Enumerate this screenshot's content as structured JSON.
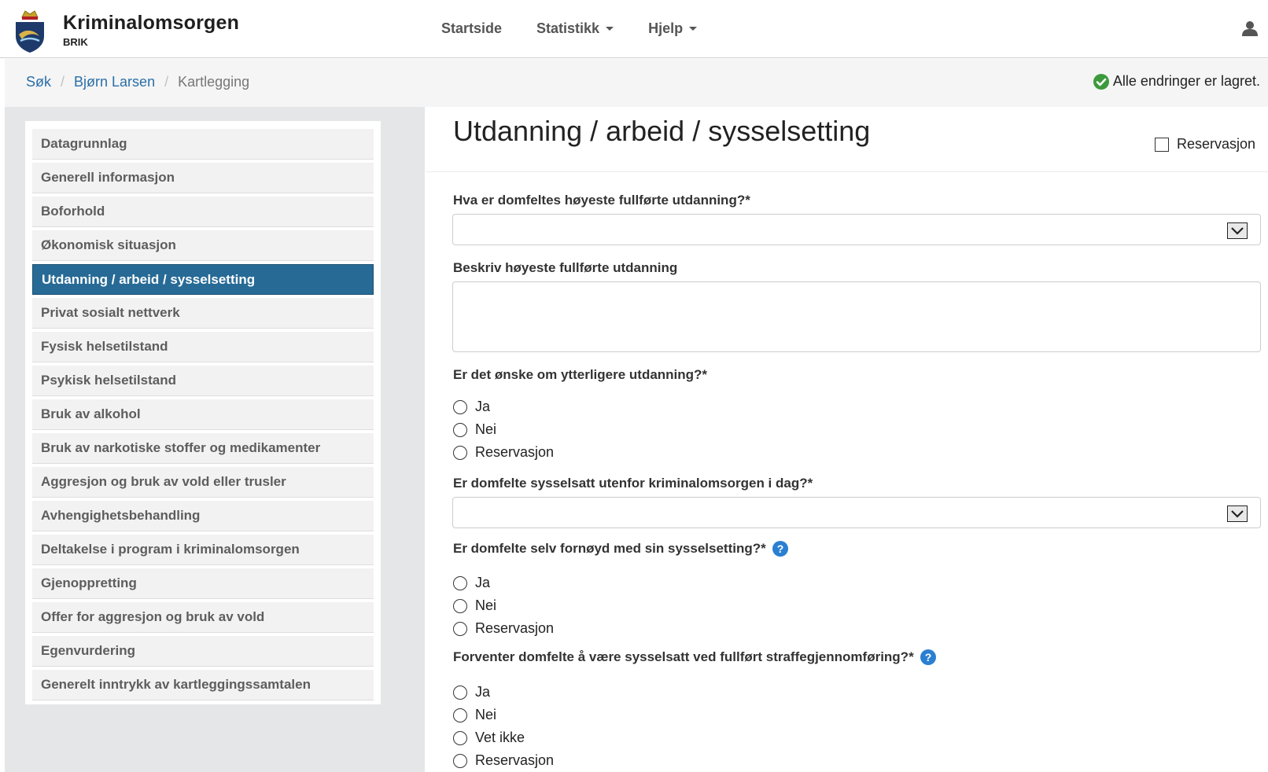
{
  "header": {
    "brand_title": "Kriminalomsorgen",
    "brand_sub": "BRIK",
    "nav": [
      "Startside",
      "Statistikk",
      "Hjelp"
    ]
  },
  "breadcrumb": {
    "items": [
      "Søk",
      "Bjørn Larsen"
    ],
    "current": "Kartlegging"
  },
  "status": {
    "saved_text": "Alle endringer er lagret."
  },
  "sidebar": {
    "items": [
      "Datagrunnlag",
      "Generell informasjon",
      "Boforhold",
      "Økonomisk situasjon",
      "Utdanning / arbeid / sysselsetting",
      "Privat sosialt nettverk",
      "Fysisk helsetilstand",
      "Psykisk helsetilstand",
      "Bruk av alkohol",
      "Bruk av narkotiske stoffer og medikamenter",
      "Aggresjon og bruk av vold eller trusler",
      "Avhengighetsbehandling",
      "Deltakelse i program i kriminalomsorgen",
      "Gjenoppretting",
      "Offer for aggresjon og bruk av vold",
      "Egenvurdering",
      "Generelt inntrykk av kartleggingssamtalen"
    ],
    "active_index": 4
  },
  "main": {
    "title": "Utdanning / arbeid / sysselsetting",
    "reservation_label": "Reservasjon",
    "q1": {
      "label": "Hva er domfeltes høyeste fullførte utdanning?*",
      "value": ""
    },
    "q2": {
      "label": "Beskriv høyeste fullførte utdanning",
      "value": ""
    },
    "q3": {
      "label": "Er det ønske om ytterligere utdanning?*",
      "options": [
        "Ja",
        "Nei",
        "Reservasjon"
      ]
    },
    "q4": {
      "label": "Er domfelte sysselsatt utenfor kriminalomsorgen i dag?*",
      "value": ""
    },
    "q5": {
      "label": "Er domfelte selv fornøyd med sin sysselsetting?*",
      "options": [
        "Ja",
        "Nei",
        "Reservasjon"
      ]
    },
    "q6": {
      "label": "Forventer domfelte å være sysselsatt ved fullført straffegjennomføring?*",
      "options": [
        "Ja",
        "Nei",
        "Vet ikke",
        "Reservasjon"
      ]
    }
  },
  "colors": {
    "accent": "#276a96",
    "link": "#2a6ea8",
    "success": "#3c9a3c",
    "help": "#2a7fd1"
  },
  "icons": {
    "logo": "coat-of-arms-icon",
    "user": "user-icon",
    "saved": "check-circle-icon",
    "help": "question-circle-icon",
    "dropdown": "chevron-down-icon"
  }
}
